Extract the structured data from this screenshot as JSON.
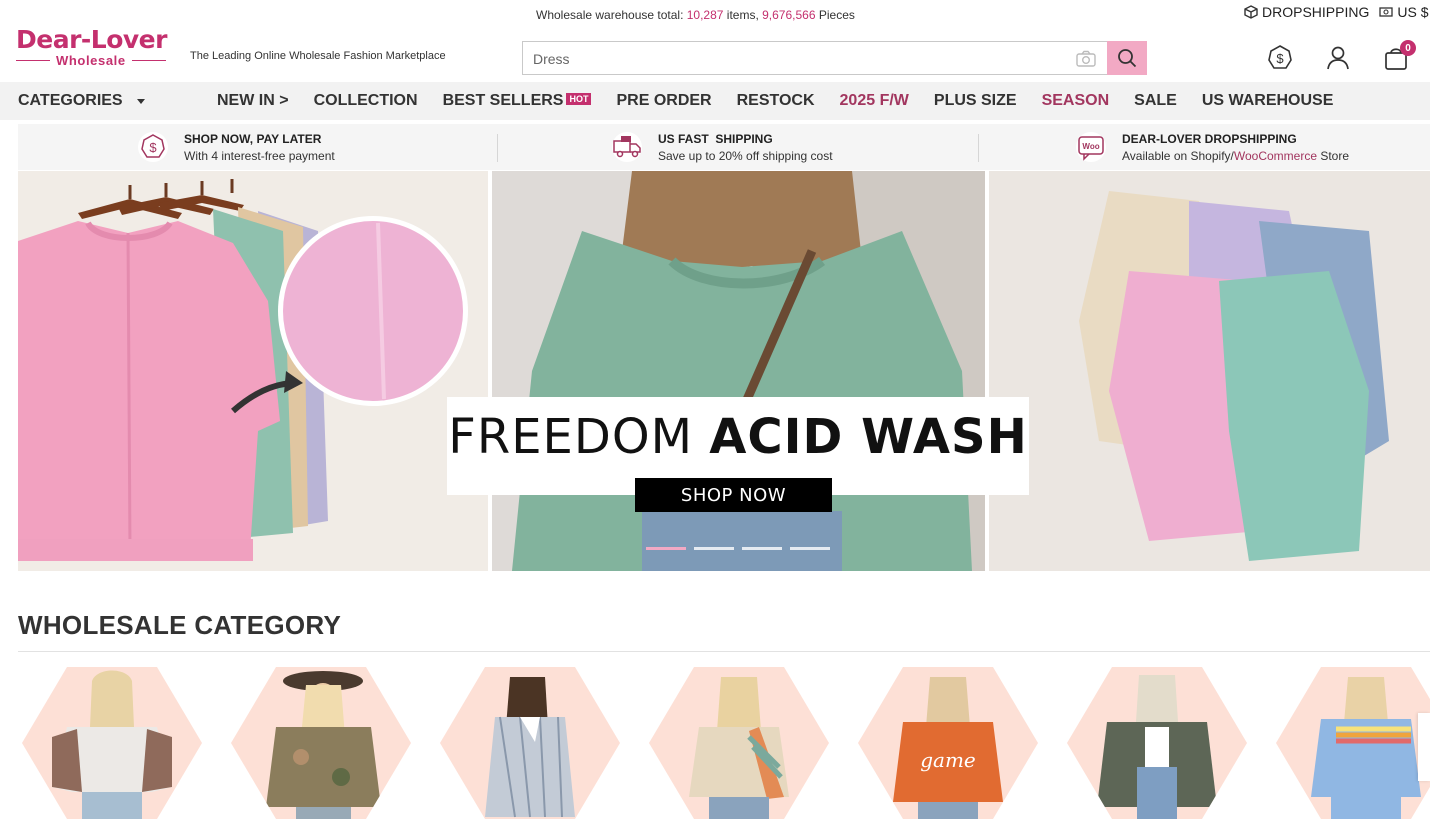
{
  "top": {
    "stats_prefix": "Wholesale warehouse total: ",
    "items_count": "10,287",
    "items_label": " items, ",
    "pieces_count": "9,676,566",
    "pieces_label": " Pieces",
    "dropshipping": "DROPSHIPPING",
    "region": "US $"
  },
  "header": {
    "brand": "Dear-Lover",
    "brand_sub": "Wholesale",
    "tagline": "The Leading Online Wholesale Fashion Marketplace",
    "search_placeholder": "Dress",
    "cart_count": "0"
  },
  "nav": {
    "categories": "CATEGORIES",
    "links": [
      {
        "label": "NEW IN >"
      },
      {
        "label": "COLLECTION"
      },
      {
        "label": "BEST SELLERS",
        "badge": "HOT"
      },
      {
        "label": "PRE ORDER"
      },
      {
        "label": "RESTOCK"
      },
      {
        "label": "2025 F/W"
      },
      {
        "label": "PLUS SIZE"
      },
      {
        "label": "SEASON"
      },
      {
        "label": "SALE"
      },
      {
        "label": "US WAREHOUSE"
      }
    ]
  },
  "benefits": [
    {
      "title": "SHOP NOW, PAY LATER",
      "sub": "With 4 interest-free payment"
    },
    {
      "title": "US FAST  SHIPPING",
      "sub": "Save up to 20% off shipping cost"
    },
    {
      "title": "DEAR-LOVER DROPSHIPPING",
      "sub_prefix": "Available on Shopify/",
      "sub_highlight": "WooCommerce",
      "sub_suffix": " Store",
      "icon_text": "Woo"
    }
  ],
  "banner": {
    "title_thin": "FREEDOM ",
    "title_bold": "ACID WASH",
    "cta": "SHOP NOW"
  },
  "category": {
    "title": "WHOLESALE CATEGORY"
  },
  "colors": {
    "brand_pink": "#c4306e",
    "nav_highlight": "#a2365f",
    "search_button": "#f2a9c4",
    "hex_bg": "#fde0d6"
  }
}
